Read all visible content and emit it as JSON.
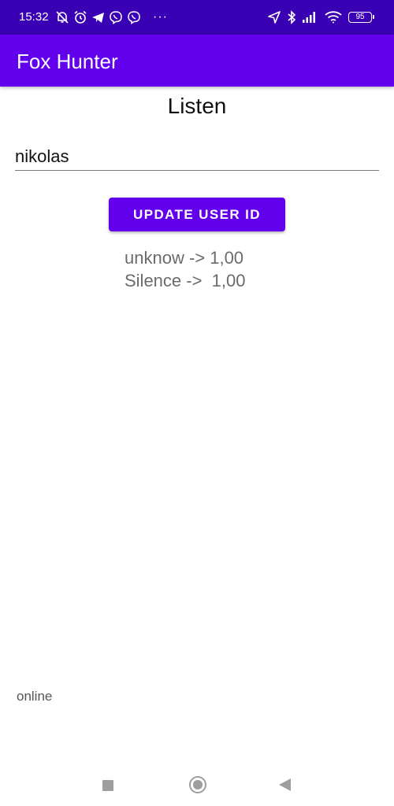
{
  "status_bar": {
    "time": "15:32",
    "battery": "95",
    "more": "···",
    "icons_left": [
      "notifications-off-icon",
      "alarm-icon",
      "telegram-icon",
      "viber-icon",
      "viber-icon"
    ],
    "icons_right": [
      "location-arrow-icon",
      "bluetooth-icon",
      "signal-icon",
      "wifi-icon",
      "battery-icon"
    ]
  },
  "app_bar": {
    "title": "Fox Hunter"
  },
  "main": {
    "heading": "Listen",
    "user_input_value": "nikolas",
    "update_button_label": "UPDATE USER ID",
    "results": [
      "unknow -> 1,00",
      "Silence ->  1,00"
    ],
    "status": "online"
  },
  "nav_bar": {
    "icons": [
      "recents-icon",
      "home-icon",
      "back-icon"
    ]
  },
  "colors": {
    "status_bar": "#3a00b3",
    "primary": "#6200ee",
    "result_text": "#6b6b6b"
  }
}
